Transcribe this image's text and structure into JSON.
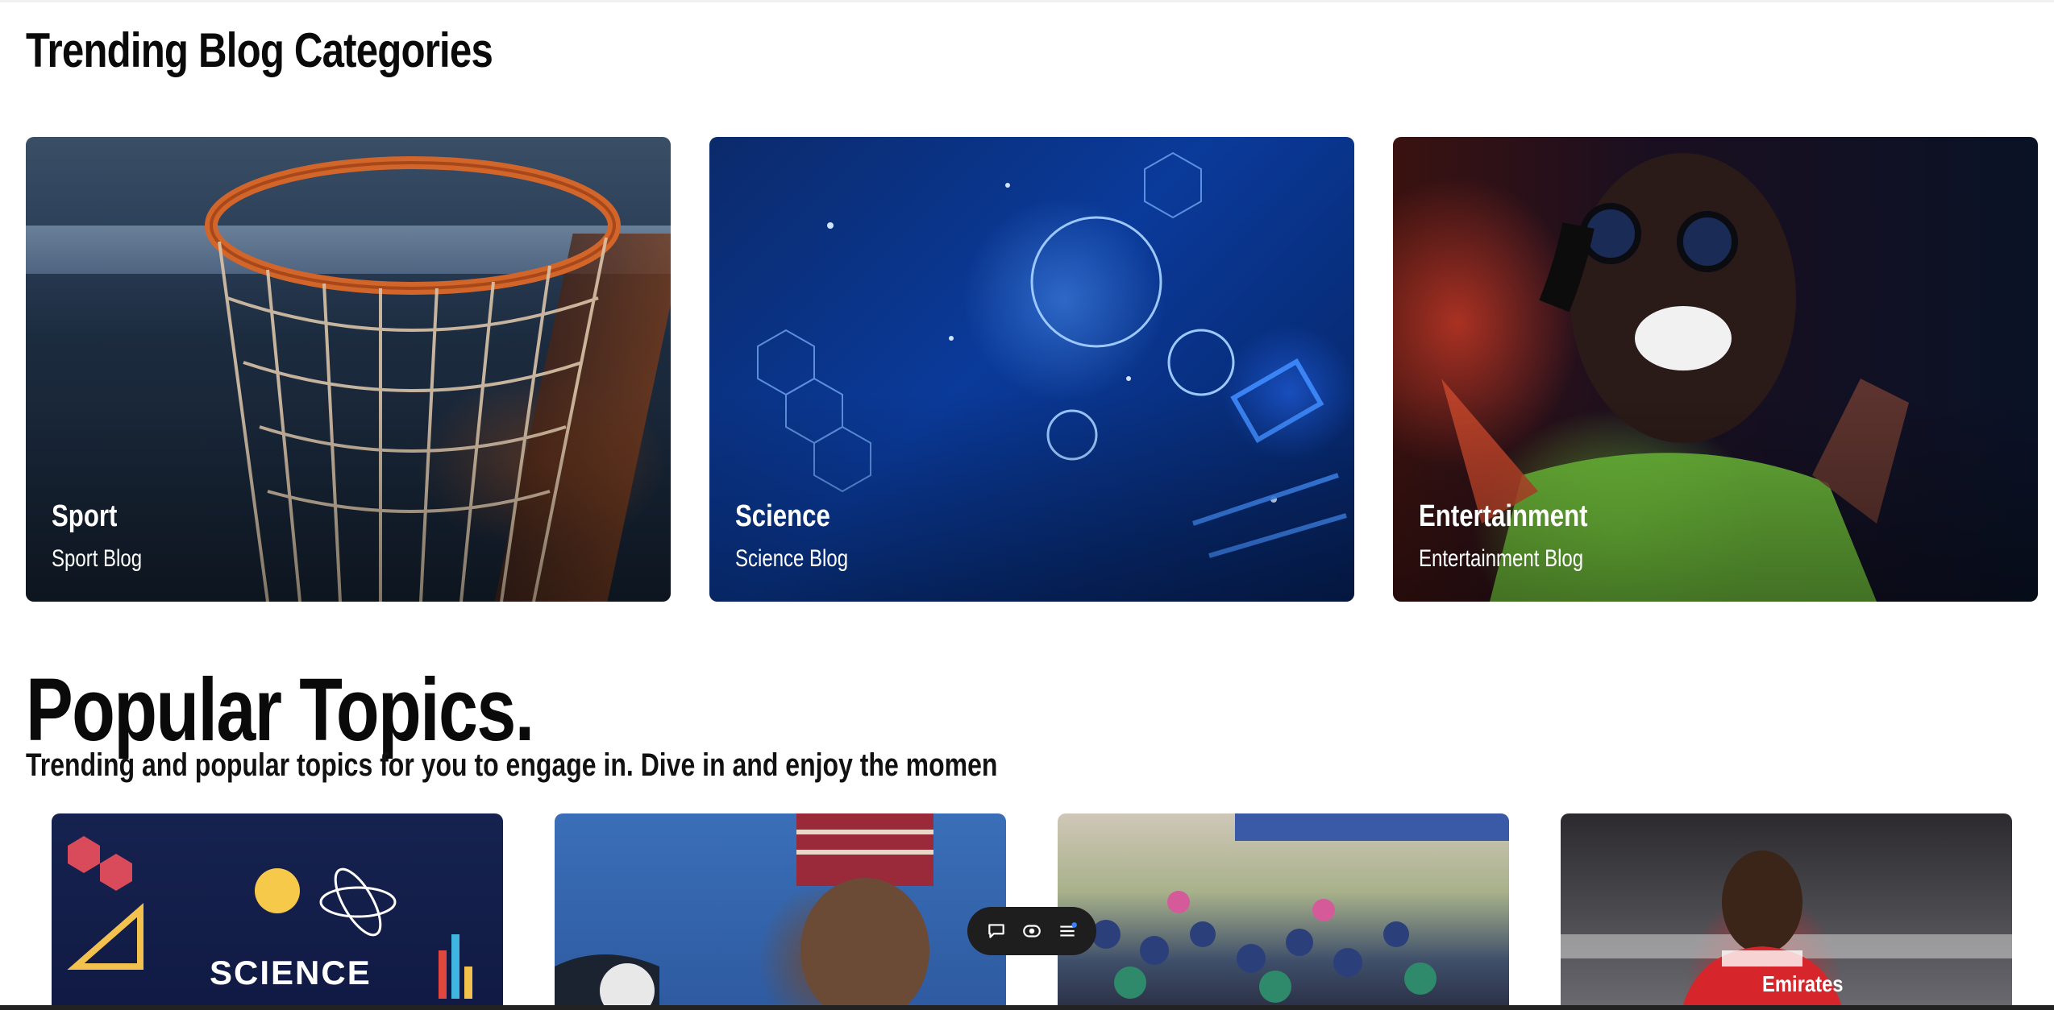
{
  "section": {
    "title": "Trending Blog Categories"
  },
  "categories": [
    {
      "title": "Sport",
      "subtitle": "Sport Blog",
      "image": "basketball-hoop-image"
    },
    {
      "title": "Science",
      "subtitle": "Science Blog",
      "image": "virus-molecule-image"
    },
    {
      "title": "Entertainment",
      "subtitle": "Entertainment Blog",
      "image": "singer-headphones-image"
    }
  ],
  "popular": {
    "title": "Popular Topics.",
    "subtitle": "Trending and popular topics for you to engage in. Dive in and enjoy the momen",
    "cards": [
      {
        "image": "science-doodle-image",
        "label": "SCIENCE"
      },
      {
        "image": "politician-image"
      },
      {
        "image": "crowd-image"
      },
      {
        "image": "footballer-image",
        "label": "Emirates"
      }
    ]
  },
  "toolbar": {
    "icons": [
      "comment-icon",
      "eye-icon",
      "menu-icon"
    ]
  }
}
